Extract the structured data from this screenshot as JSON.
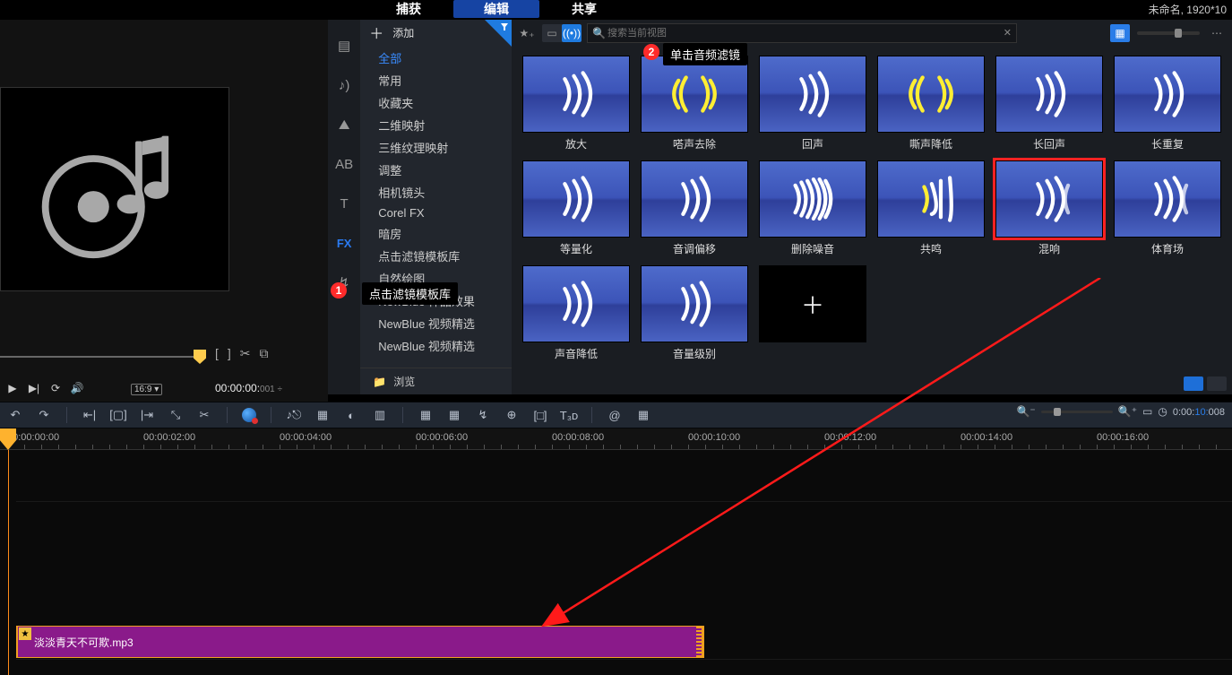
{
  "top": {
    "tabs": [
      "捕获",
      "编辑",
      "共享"
    ],
    "active": 1,
    "project_info": "未命名, 1920*10"
  },
  "preview": {
    "icons": [
      "[",
      "]",
      "✂",
      "⧉"
    ],
    "play_icons": [
      "▶",
      "▶|",
      "⟳",
      "🔊"
    ],
    "aspect": "16:9 ▾",
    "dur_main": "00:00:00:",
    "dur_small": "001 ÷"
  },
  "lib": {
    "col_icons": [
      "media-icon",
      "audio-icon",
      "template-icon",
      "title-icon",
      "text-icon",
      "fx-icon",
      "path-icon"
    ],
    "col_glyphs": [
      "▤",
      "♪)",
      "⛰",
      "AB",
      "T",
      "FX",
      "↯"
    ],
    "fx_index": 5,
    "add_label": "添加",
    "categories": [
      "全部",
      "常用",
      "收藏夹",
      "二维映射",
      "三维纹理映射",
      "调整",
      "相机镜头",
      "Corel FX",
      "暗房",
      "点击滤镜模板库",
      "自然绘图",
      "NewBlue 样品效果",
      "NewBlue 视频精选",
      "NewBlue 视频精选"
    ],
    "active_cat": 0,
    "browse": "浏览",
    "search_placeholder": "搜索当前视图",
    "thumbs": [
      {
        "label": "放大",
        "wave": "w1"
      },
      {
        "label": "嗒声去除",
        "wave": "yel2"
      },
      {
        "label": "回声",
        "wave": "w1"
      },
      {
        "label": "嘶声降低",
        "wave": "yel2"
      },
      {
        "label": "长回声",
        "wave": "w1"
      },
      {
        "label": "长重复",
        "wave": "w1"
      },
      {
        "label": "等量化",
        "wave": "w1"
      },
      {
        "label": "音调偏移",
        "wave": "w1"
      },
      {
        "label": "删除噪音",
        "wave": "dense"
      },
      {
        "label": "共鸣",
        "wave": "yel1"
      },
      {
        "label": "混响",
        "wave": "rev",
        "hl": true
      },
      {
        "label": "体育场",
        "wave": "rev"
      },
      {
        "label": "声音降低",
        "wave": "w1"
      },
      {
        "label": "音量级别",
        "wave": "w1"
      },
      {
        "label": "",
        "add": true
      }
    ]
  },
  "callouts": {
    "b1": "1",
    "c1": "点击滤镜模板库",
    "b2": "2",
    "c2": "单击音频滤镜"
  },
  "timeline": {
    "bar_icons": [
      "↶",
      "↷",
      "|",
      "⇤|",
      "[▢]",
      "|⇥",
      "⤡",
      "✂",
      "|",
      "●",
      "|",
      "♪⎋",
      "▦",
      "◐",
      "▥",
      "|",
      "▦",
      "▦",
      "↯",
      "⊕",
      "[□]",
      "T₃ᴅ",
      "|",
      "@",
      "▦"
    ],
    "zoom_tc_a": "0:00:",
    "zoom_tc_b": "10:",
    "zoom_tc_c": "008",
    "ticks": [
      "00:00:00:00",
      "00:00:02:00",
      "00:00:04:00",
      "00:00:06:00",
      "00:00:08:00",
      "00:00:10:00",
      "00:00:12:00",
      "00:00:14:00",
      "00:00:16:00"
    ],
    "tick_step": 152,
    "clip_name": "淡淡青天不可欺.mp3",
    "clip_width": 768
  }
}
